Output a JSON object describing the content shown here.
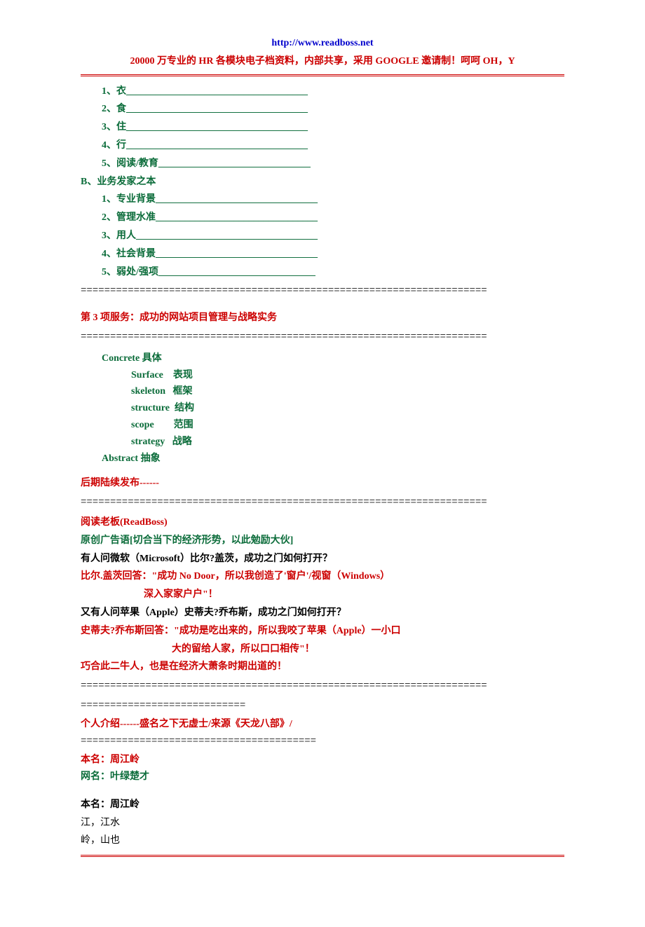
{
  "header": {
    "url": "http://www.readboss.net",
    "banner": "20000 万专业的 HR 各模块电子档资料，内部共享，采用 GOOGLE 邀请制！呵呵 OH，Y"
  },
  "listA": [
    {
      "label": "1、衣_____________________________________"
    },
    {
      "label": "2、食_____________________________________"
    },
    {
      "label": "3、住_____________________________________"
    },
    {
      "label": "4、行_____________________________________"
    },
    {
      "label": "5、阅读/教育_______________________________"
    }
  ],
  "sectionB": {
    "heading": "B、业务发家之本",
    "items": [
      {
        "label": "1、专业背景_________________________________"
      },
      {
        "label": "2、管理水准_________________________________"
      },
      {
        "label": "3、用人_____________________________________"
      },
      {
        "label": "4、社会背景_________________________________"
      },
      {
        "label": "5、弱处/强项________________________________"
      }
    ]
  },
  "eqline_long": "=====================================================================",
  "service3": {
    "title": "第 3 项服务：成功的网站项目管理与战略实务",
    "concrete": "Concrete  具体",
    "rows": [
      {
        "en": "Surface",
        "zh": "表现"
      },
      {
        "en": "skeleton",
        "zh": "框架"
      },
      {
        "en": "structure",
        "zh": "结构"
      },
      {
        "en": "scope",
        "zh": "范围"
      },
      {
        "en": "strategy",
        "zh": "战略"
      }
    ],
    "abstract": "Abstract   抽象"
  },
  "later_publish": "后期陆续发布------",
  "readboss": {
    "title": "阅读老板(ReadBoss)",
    "slogan": "原创广告语[切合当下的经济形势，以此勉励大伙]",
    "q1": "有人问微软（Microsoft）比尔?盖茨，成功之门如何打开？",
    "a1_line1": "比尔.盖茨回答：\"成功 No Door，所以我创造了'窗户'/视窗（Windows）",
    "a1_line2": "深入家家户户\"！",
    "q2": "又有人问苹果（Apple）史蒂夫?乔布斯，成功之门如何打开？",
    "a2_line1": "史蒂夫?乔布斯回答：\"成功是吃出来的，所以我咬了苹果（Apple）一小口",
    "a2_line2": "大的留给人家，所以口口相传\"！",
    "coincidence": "巧合此二牛人，也是在经济大萧条时期出道的！"
  },
  "short_eq1": "============================",
  "intro_title": "个人介绍------盛名之下无虚士/来源《天龙八部》/",
  "short_eq2": "========================================",
  "realname": {
    "label": "本名：",
    "value": "周江岭"
  },
  "netname": {
    "label": "网名：",
    "value": "叶绿楚才"
  },
  "realname2": "本名：周江岭",
  "river": "江，江水",
  "mountain": "岭，山也"
}
